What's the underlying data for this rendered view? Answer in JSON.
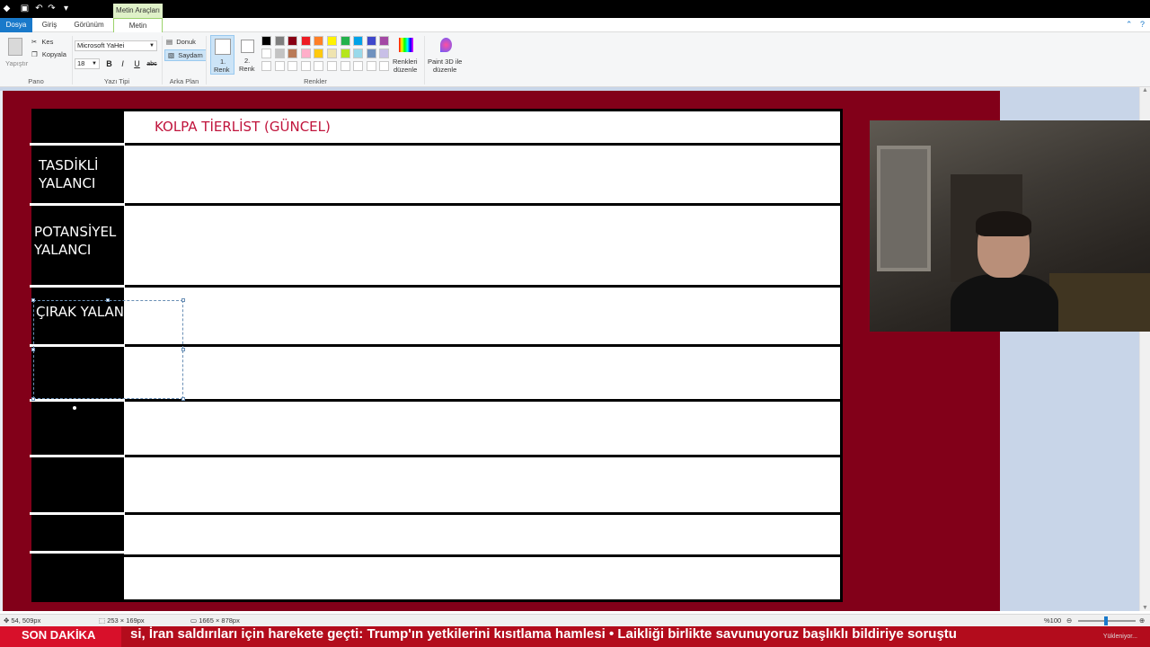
{
  "titlebar": {
    "contextual_tab": "Metin Araçları"
  },
  "tabs": {
    "dosya": "Dosya",
    "giris": "Giriş",
    "gorunum": "Görünüm",
    "metin": "Metin"
  },
  "ribbon": {
    "pano": {
      "paste": "Yapıştır",
      "cut": "Kes",
      "copy": "Kopyala",
      "label": "Pano"
    },
    "yazi_tipi": {
      "font_name": "Microsoft YaHei",
      "font_size": "18",
      "bold": "B",
      "italic": "I",
      "underline": "U",
      "strike": "abc",
      "label": "Yazı Tipi"
    },
    "arka_plan": {
      "opaque": "Donuk",
      "transparent": "Saydam",
      "label": "Arka Plan"
    },
    "renkler": {
      "color1_line1": "1.",
      "color1_line2": "Renk",
      "color2_line1": "2.",
      "color2_line2": "Renk",
      "edit_colors_line1": "Renkleri",
      "edit_colors_line2": "düzenle",
      "paint3d_line1": "Paint 3D ile",
      "paint3d_line2": "düzenle",
      "label": "Renkler",
      "palette_row1": [
        "#000000",
        "#7f7f7f",
        "#880015",
        "#ed1c24",
        "#ff7f27",
        "#fff200",
        "#22b14c",
        "#00a2e8",
        "#3f48cc",
        "#a349a4"
      ],
      "palette_row2": [
        "#ffffff",
        "#c3c3c3",
        "#b97a57",
        "#ffaec9",
        "#ffc90e",
        "#efe4b0",
        "#b5e61d",
        "#99d9ea",
        "#7092be",
        "#c8bfe7"
      ]
    }
  },
  "canvas": {
    "title": "KOLPA TİERLİST (GÜNCEL)",
    "tiers": [
      {
        "label": "TASDİKLİ\nYALANCI"
      },
      {
        "label": "POTANSİYEL\nYALANCI"
      },
      {
        "label": "ÇIRAK YALAN"
      },
      {
        "label": ""
      },
      {
        "label": ""
      },
      {
        "label": ""
      },
      {
        "label": ""
      },
      {
        "label": ""
      }
    ],
    "colors": {
      "background": "#820019",
      "label_column": "#000000",
      "title": "#c0143c"
    }
  },
  "statusbar": {
    "cursor": "54, 509px",
    "selection": "253 × 169px",
    "image_size": "1665 × 878px",
    "zoom": "%100"
  },
  "ticker": {
    "badge": "SON DAKİKA",
    "text": "si, İran saldırıları için harekete geçti: Trump'ın yetkilerini kısıtlama hamlesi  •  Laikliği birlikte savunuyoruz başlıklı bildiriye soruştu",
    "upload": "Yükleniyor..."
  }
}
